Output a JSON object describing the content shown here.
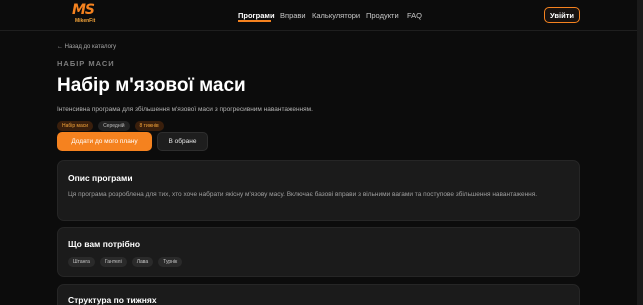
{
  "header": {
    "logo_text": "MS",
    "logo_sub": "MikenFit",
    "nav": [
      "Програми",
      "Вправи",
      "Калькулятори",
      "Продукти",
      "FAQ"
    ],
    "login_label": "Увійти"
  },
  "page": {
    "back_link": "← Назад до каталогу",
    "eyebrow": "НАБІР МАСИ",
    "title": "Набір м'язової маси",
    "subtitle": "Інтенсивна програма для збільшення м'язової маси з прогресивним навантаженням.",
    "tags": [
      "Набір маси",
      "Середній",
      "8 тижнів"
    ],
    "primary_button": "Додати до мого плану",
    "secondary_button": "В обране"
  },
  "description": {
    "title": "Опис програми",
    "text": "Ця програма розроблена для тих, хто хоче набрати якісну м'язову масу. Включає базові вправи з вільними вагами та поступове збільшення навантаження."
  },
  "requirements": {
    "title": "Що вам потрібно",
    "items": [
      "Штанга",
      "Гантелі",
      "Лава",
      "Турнік"
    ]
  },
  "structure": {
    "title": "Структура по тижнях"
  },
  "colors": {
    "accent": "#f5821f",
    "background": "#0c0c0c",
    "card": "#1b1b1b"
  }
}
